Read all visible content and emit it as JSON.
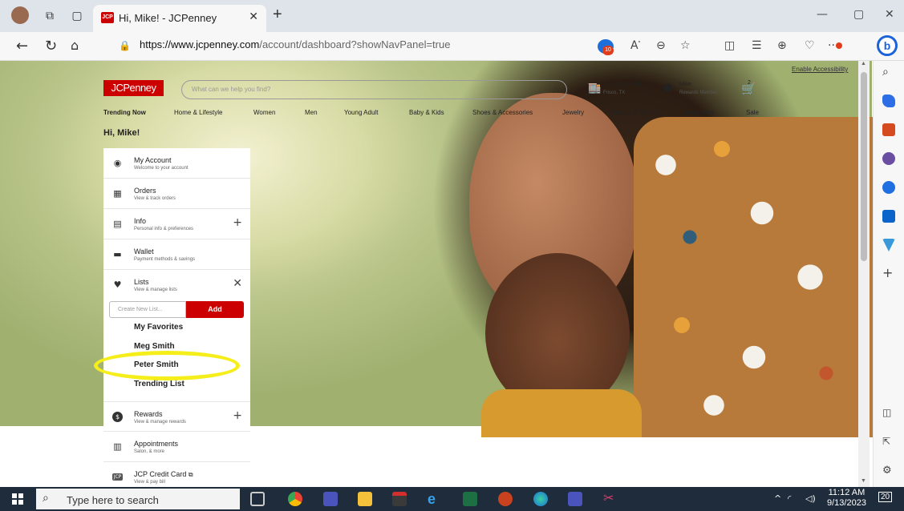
{
  "browser": {
    "tab_title": "Hi, Mike! - JCPenney",
    "tab_favicon": "JCP",
    "url_prefix": "https://www.jcpenney.com",
    "url_path": "/account/dashboard?showNavPanel=true",
    "extension_badge": "10",
    "notification_badge": "20"
  },
  "header": {
    "enable_accessibility": "Enable Accessibility",
    "logo": "JCPenney",
    "search_placeholder": "What can we help you find?",
    "store_name": "Stonebriar Mall",
    "store_location": "Frisco, TX",
    "user_name": "Mike",
    "user_status": "Rewards Member",
    "cart_count": "2"
  },
  "nav": [
    "Trending Now",
    "Home & Lifestyle",
    "Women",
    "Men",
    "Young Adult",
    "Baby & Kids",
    "Shoes & Accessories",
    "Jewelry",
    "Beauty & Salon",
    "Inspiration",
    "Sale"
  ],
  "greeting": "Hi, Mike!",
  "panel": {
    "rows": [
      {
        "title": "My Account",
        "subtitle": "Welcome to your account",
        "icon": "account-icon"
      },
      {
        "title": "Orders",
        "subtitle": "View & track orders",
        "icon": "box-icon"
      },
      {
        "title": "Info",
        "subtitle": "Personal info & preferences",
        "icon": "id-card-icon"
      },
      {
        "title": "Wallet",
        "subtitle": "Payment methods & savings",
        "icon": "wallet-icon"
      },
      {
        "title": "Lists",
        "subtitle": "View & manage lists",
        "icon": "heart-icon"
      },
      {
        "title": "Rewards",
        "subtitle": "View & manage rewards",
        "icon": "rewards-icon"
      },
      {
        "title": "Appointments",
        "subtitle": "Salon, & more",
        "icon": "calendar-icon"
      },
      {
        "title": "JCP Credit Card",
        "subtitle": "View & pay bill",
        "icon": "credit-card-icon"
      }
    ],
    "new_list_placeholder": "Create New List...",
    "add_label": "Add",
    "lists": [
      "My Favorites",
      "Meg Smith",
      "Peter Smith",
      "Trending List"
    ]
  },
  "taskbar": {
    "search_placeholder": "Type here to search",
    "time": "11:12 AM",
    "date": "9/13/2023"
  },
  "colors": {
    "brand": "#cc0000",
    "highlight": "#f5ee1a",
    "taskbar": "#1e2c3c"
  }
}
